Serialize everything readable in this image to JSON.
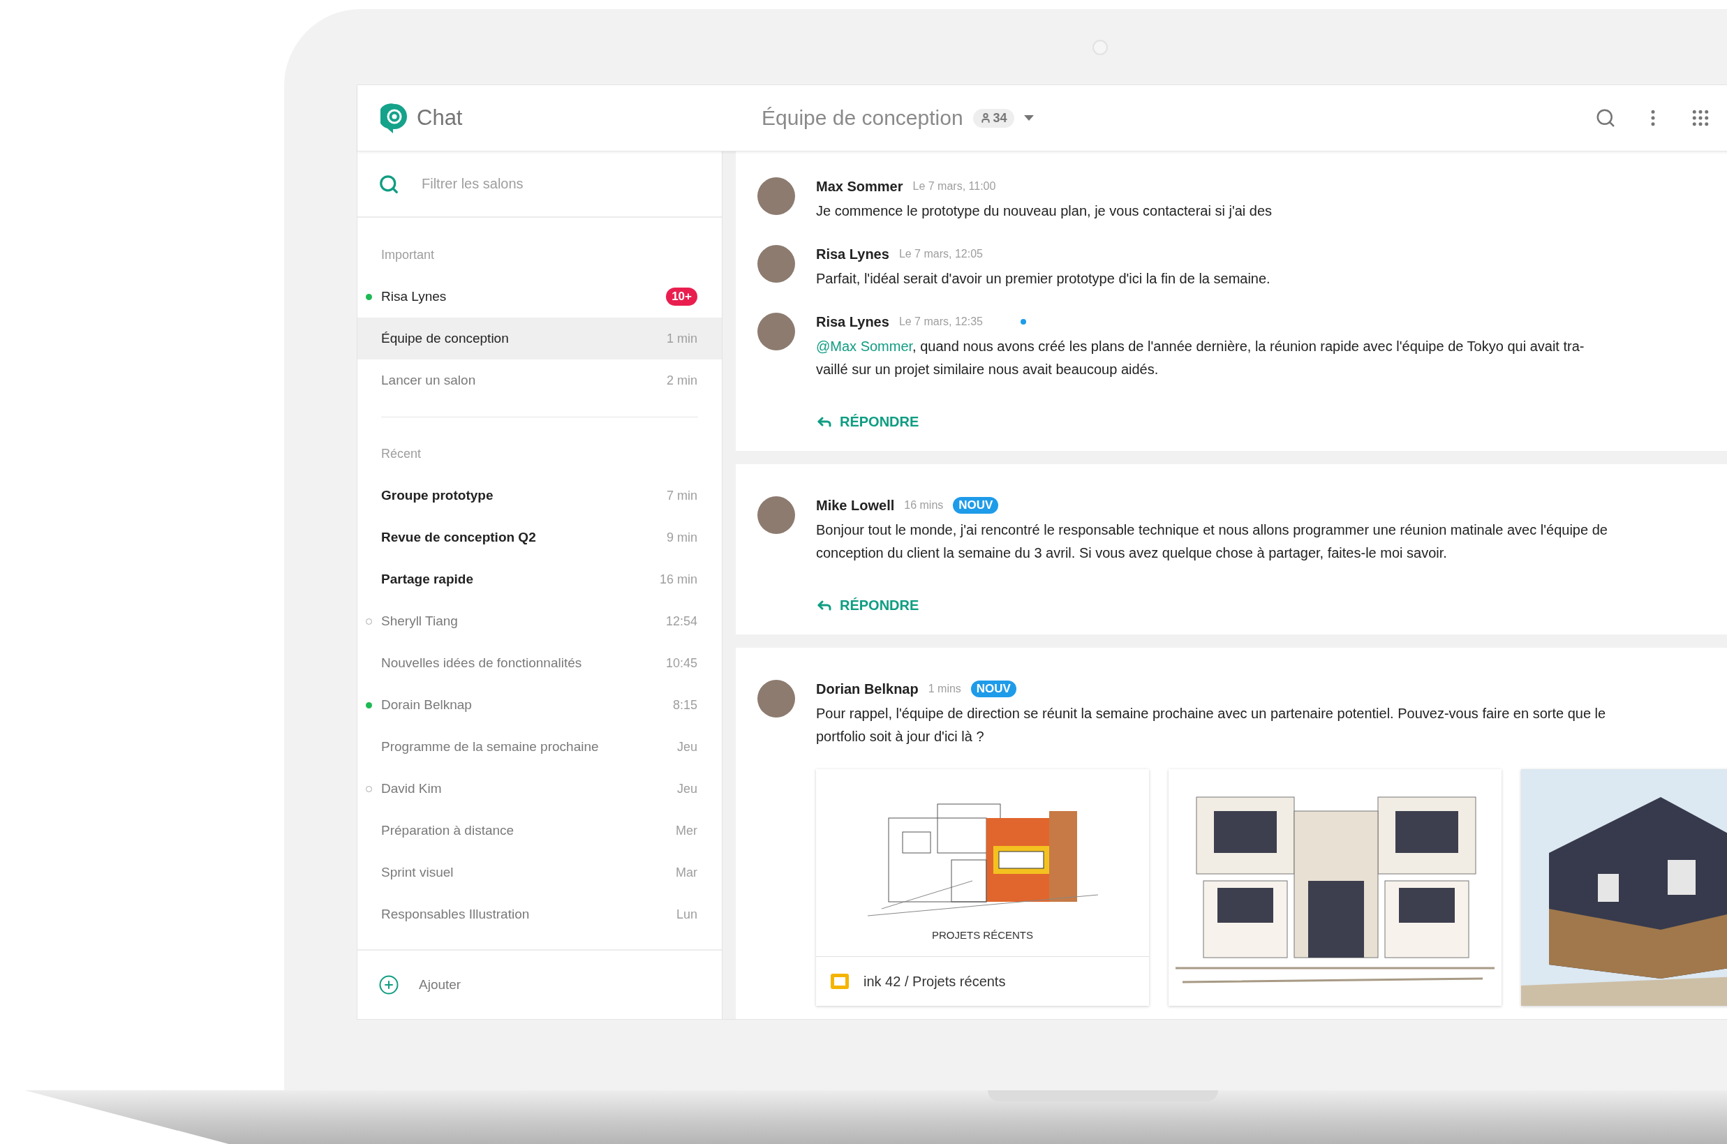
{
  "app": {
    "name": "Chat"
  },
  "header": {
    "title": "Équipe de conception",
    "member_count": "34"
  },
  "sidebar": {
    "search": {
      "placeholder": "Filtrer les salons"
    },
    "sections": [
      {
        "title": "Important",
        "items": [
          {
            "name": "Risa Lynes",
            "badge": "10+",
            "online": true,
            "unread": false,
            "selected": false
          },
          {
            "name": "Équipe de conception",
            "time": "1 min",
            "unread": false,
            "selected": true
          },
          {
            "name": "Lancer un salon",
            "time": "2 min",
            "unread": false,
            "selected": false
          }
        ]
      },
      {
        "title": "Récent",
        "items": [
          {
            "name": "Groupe prototype",
            "time": "7 min",
            "unread": true,
            "selected": false
          },
          {
            "name": "Revue de conception Q2",
            "time": "9 min",
            "unread": true,
            "selected": false
          },
          {
            "name": "Partage rapide",
            "time": "16 min",
            "unread": true,
            "selected": false
          },
          {
            "name": "Sheryll Tiang",
            "time": "12:54",
            "online": false,
            "unread": false,
            "selected": false
          },
          {
            "name": "Nouvelles idées de fonctionnalités",
            "time": "10:45",
            "unread": false,
            "selected": false
          },
          {
            "name": "Dorain Belknap",
            "time": "8:15",
            "online": true,
            "unread": false,
            "selected": false
          },
          {
            "name": "Programme de la semaine prochaine",
            "time": "Jeu",
            "unread": false,
            "selected": false
          },
          {
            "name": "David Kim",
            "time": "Jeu",
            "online": false,
            "unread": false,
            "selected": false
          },
          {
            "name": "Préparation à distance",
            "time": "Mer",
            "unread": false,
            "selected": false
          },
          {
            "name": "Sprint visuel",
            "time": "Mar",
            "unread": false,
            "selected": false
          },
          {
            "name": "Responsables Illustration",
            "time": "Lun",
            "unread": false,
            "selected": false
          }
        ]
      }
    ],
    "add_label": "Ajouter"
  },
  "threads": [
    {
      "messages": [
        {
          "author": "Max Sommer",
          "time": "Le 7 mars, 11:00",
          "text": "Je commence le prototype du nouveau plan, je vous contacterai si j'ai des",
          "unread_dot": false
        },
        {
          "author": "Risa Lynes",
          "time": "Le 7 mars, 12:05",
          "text": "Parfait, l'idéal serait d'avoir un premier prototype d'ici la fin de la semaine.",
          "unread_dot": false
        },
        {
          "author": "Risa Lynes",
          "time": "Le 7 mars, 12:35",
          "mention": "@Max Sommer",
          "text": ", quand nous avons créé les plans de l'année dernière, la réunion rapide avec l'équipe de Tokyo qui avait tra-vaillé sur un projet similaire nous avait beaucoup aidés.",
          "unread_dot": true
        }
      ],
      "reply_label": "RÉPONDRE"
    },
    {
      "messages": [
        {
          "author": "Mike Lowell",
          "time": "16 mins",
          "badge": "NOUV",
          "text": "Bonjour tout le monde, j'ai rencontré le responsable technique et nous allons programmer une réunion matinale avec l'équipe de conception du client la semaine du 3 avril. Si vous avez quelque chose à partager, faites-le moi savoir.",
          "unread_dot": false
        }
      ],
      "reply_label": "RÉPONDRE"
    },
    {
      "messages": [
        {
          "author": "Dorian Belknap",
          "time": "1 mins",
          "badge": "NOUV",
          "text": "Pour rappel, l'équipe de direction se réunit la semaine prochaine avec un partenaire potentiel. Pouvez-vous faire en sorte que le portfolio soit à jour d'ici là ?",
          "unread_dot": false
        }
      ],
      "attachments": [
        {
          "kind": "slides",
          "caption": "PROJETS RÉCENTS",
          "title": "ink 42 / Projets récents"
        },
        {
          "kind": "image"
        },
        {
          "kind": "image"
        }
      ]
    }
  ]
}
